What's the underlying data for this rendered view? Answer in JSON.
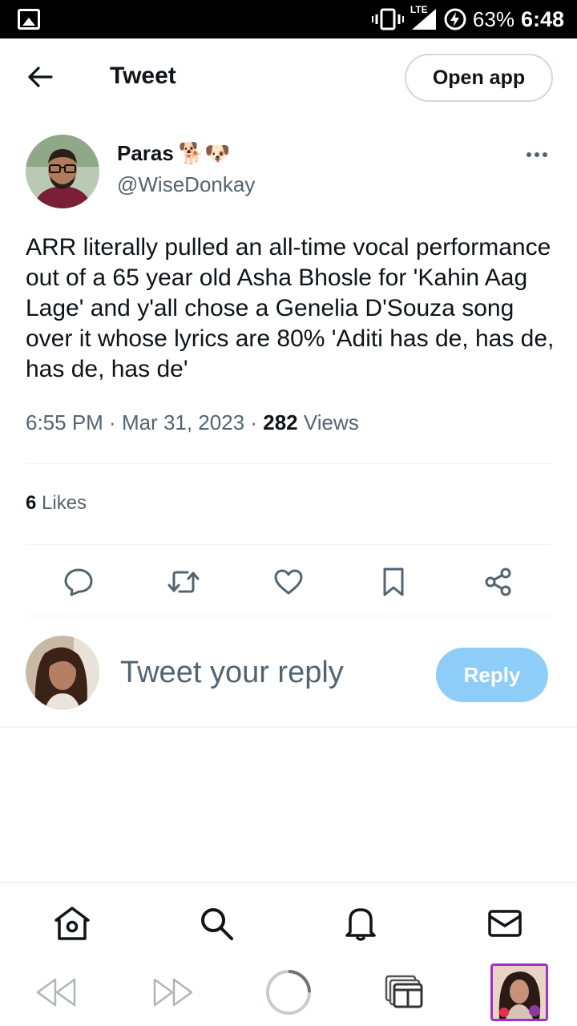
{
  "status_bar": {
    "network": "LTE",
    "battery": "63%",
    "time": "6:48"
  },
  "header": {
    "title": "Tweet",
    "open_app_label": "Open app"
  },
  "tweet": {
    "author_name": "Paras",
    "author_emoji": "🐕🐶",
    "handle": "@WiseDonkay",
    "text": "ARR literally pulled an all-time vocal performance out of a 65 year old Asha Bhosle for 'Kahin Aag Lage' and y'all chose a Genelia D'Souza song over it whose lyrics are 80% 'Aditi has de, has de, has de, has de'",
    "time": "6:55 PM",
    "date": "Mar 31, 2023",
    "views_count": "282",
    "views_label": "Views",
    "likes_count": "6",
    "likes_label": "Likes"
  },
  "reply": {
    "placeholder": "Tweet your reply",
    "button_label": "Reply"
  },
  "colors": {
    "accent_light": "#8ecdf8",
    "text_secondary": "#536471",
    "text_primary": "#0f1419",
    "tab_highlight": "#a030c8"
  },
  "icons": {
    "back": "arrow-left-icon",
    "more": "more-dots-icon",
    "reply": "comment-icon",
    "retweet": "retweet-icon",
    "like": "heart-icon",
    "bookmark": "bookmark-icon",
    "share": "share-icon",
    "home": "home-icon",
    "search": "search-icon",
    "notifications": "bell-icon",
    "messages": "envelope-icon"
  }
}
